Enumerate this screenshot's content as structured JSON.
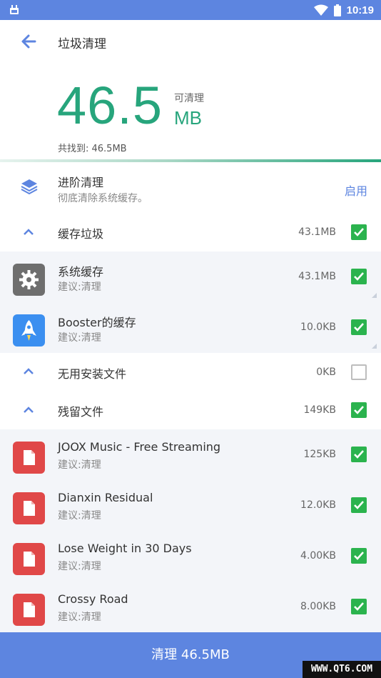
{
  "status_bar": {
    "time": "10:19",
    "left_icon": "cleaner-icon",
    "wifi_icon": "wifi-icon",
    "battery_icon": "battery-icon"
  },
  "header": {
    "title": "垃圾清理",
    "back_icon": "arrow-left-icon"
  },
  "summary": {
    "amount": "46.5",
    "label": "可清理",
    "unit": "MB",
    "found": "共找到: 46.5MB"
  },
  "advanced": {
    "title": "进阶清理",
    "subtitle": "彻底清除系统缓存。",
    "action": "启用",
    "icon": "layers-icon"
  },
  "groups": {
    "cache": {
      "title": "缓存垃圾",
      "size": "43.1MB",
      "checked": true,
      "items": [
        {
          "name": "系统缓存",
          "sub": "建议:清理",
          "size": "43.1MB",
          "checked": true,
          "icon": "gear-icon"
        },
        {
          "name": "Booster的缓存",
          "sub": "建议:清理",
          "size": "10.0KB",
          "checked": true,
          "icon": "rocket-icon"
        }
      ]
    },
    "apk": {
      "title": "无用安装文件",
      "size": "0KB",
      "checked": false
    },
    "residual": {
      "title": "残留文件",
      "size": "149KB",
      "checked": true,
      "items": [
        {
          "name": "JOOX Music - Free Streaming",
          "sub": "建议:清理",
          "size": "125KB",
          "checked": true,
          "icon": "file-icon"
        },
        {
          "name": "Dianxin Residual",
          "sub": "建议:清理",
          "size": "12.0KB",
          "checked": true,
          "icon": "file-icon"
        },
        {
          "name": "Lose Weight in 30 Days",
          "sub": "建议:清理",
          "size": "4.00KB",
          "checked": true,
          "icon": "file-icon"
        },
        {
          "name": "Crossy Road",
          "sub": "建议:清理",
          "size": "8.00KB",
          "checked": true,
          "icon": "file-icon"
        }
      ]
    }
  },
  "bottom_button": {
    "label": "清理 46.5MB"
  },
  "watermark": "WWW.QT6.COM",
  "colors": {
    "accent": "#5d85e0",
    "green": "#27a57c",
    "check": "#2bb34e",
    "file_red": "#e04848",
    "gear_grey": "#6e6e6e",
    "booster_blue": "#3b8ff0"
  }
}
